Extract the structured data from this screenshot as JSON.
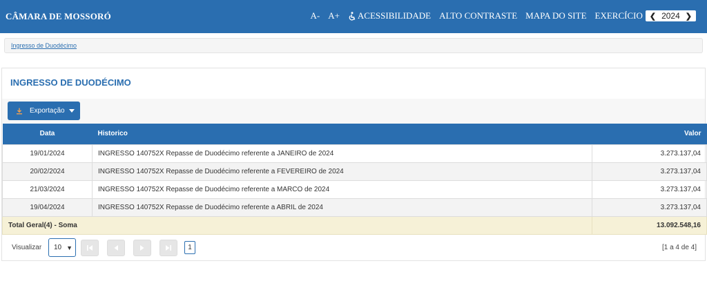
{
  "header": {
    "brand": "CÂMARA DE MOSSORÓ",
    "font_decrease": "A-",
    "font_increase": "A+",
    "accessibility": "ACESSIBILIDADE",
    "high_contrast": "ALTO CONTRASTE",
    "sitemap": "MAPA DO SITE",
    "year_label": "EXERCÍCIO",
    "year": "2024"
  },
  "breadcrumb": {
    "current": "Ingresso de Duodécimo"
  },
  "page": {
    "title": "INGRESSO DE DUODÉCIMO",
    "export_label": "Exportação"
  },
  "table": {
    "columns": {
      "date": "Data",
      "history": "Historico",
      "value": "Valor"
    },
    "rows": [
      {
        "date": "19/01/2024",
        "history": "INGRESSO 140752X Repasse de Duodécimo referente a JANEIRO de 2024",
        "value": "3.273.137,04"
      },
      {
        "date": "20/02/2024",
        "history": "INGRESSO 140752X Repasse de Duodécimo referente a FEVEREIRO de 2024",
        "value": "3.273.137,04"
      },
      {
        "date": "21/03/2024",
        "history": "INGRESSO 140752X Repasse de Duodécimo referente a MARCO de 2024",
        "value": "3.273.137,04"
      },
      {
        "date": "19/04/2024",
        "history": "INGRESSO 140752X Repasse de Duodécimo referente a ABRIL de 2024",
        "value": "3.273.137,04"
      }
    ],
    "total_label": "Total Geral(4) - Soma",
    "total_value": "13.092.548,16"
  },
  "pager": {
    "view_label": "Visualizar",
    "page_size": "10",
    "current_page": "1",
    "range": "[1 a 4 de 4]"
  },
  "colors": {
    "primary": "#2a6eb0",
    "total_row": "#f6f1d7",
    "alt_row": "#f3f3f3"
  },
  "icons": {
    "accessibility": "accessibility-icon",
    "download": "download-icon",
    "first": "first-page-icon",
    "prev": "prev-page-icon",
    "next": "next-page-icon",
    "last": "last-page-icon"
  }
}
